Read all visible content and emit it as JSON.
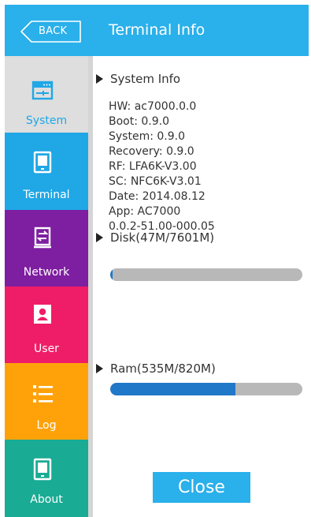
{
  "header": {
    "back_label": "BACK",
    "title": "Terminal Info"
  },
  "sidebar": {
    "items": [
      {
        "label": "System",
        "icon": "system-icon",
        "active": true,
        "color": "#dedede"
      },
      {
        "label": "Terminal",
        "icon": "terminal-icon",
        "color": "#1fa7e6"
      },
      {
        "label": "Network",
        "icon": "network-icon",
        "color": "#7e1ea0"
      },
      {
        "label": "User",
        "icon": "user-icon",
        "color": "#ef1d67"
      },
      {
        "label": "Log",
        "icon": "log-icon",
        "color": "#ffa20a"
      },
      {
        "label": "About",
        "icon": "about-icon",
        "color": "#1aab94"
      }
    ]
  },
  "system_info": {
    "heading": "System Info",
    "lines": [
      "HW: ac7000.0.0",
      "Boot: 0.9.0",
      "System: 0.9.0",
      "Recovery: 0.9.0",
      "RF: LFA6K-V3.00",
      "SC: NFC6K-V3.01",
      "Date: 2014.08.12",
      "App: AC7000",
      "0.0.2-51.00-000.05"
    ]
  },
  "disk": {
    "label": "Disk(47M/7601M)",
    "used_fraction": 0.0062
  },
  "ram": {
    "label": "Ram(535M/820M)",
    "used_fraction": 0.652
  },
  "close_label": "Close",
  "colors": {
    "accent": "#2ab0ea",
    "progress_fill": "#1f78c8",
    "progress_track": "#b8b8b8"
  }
}
